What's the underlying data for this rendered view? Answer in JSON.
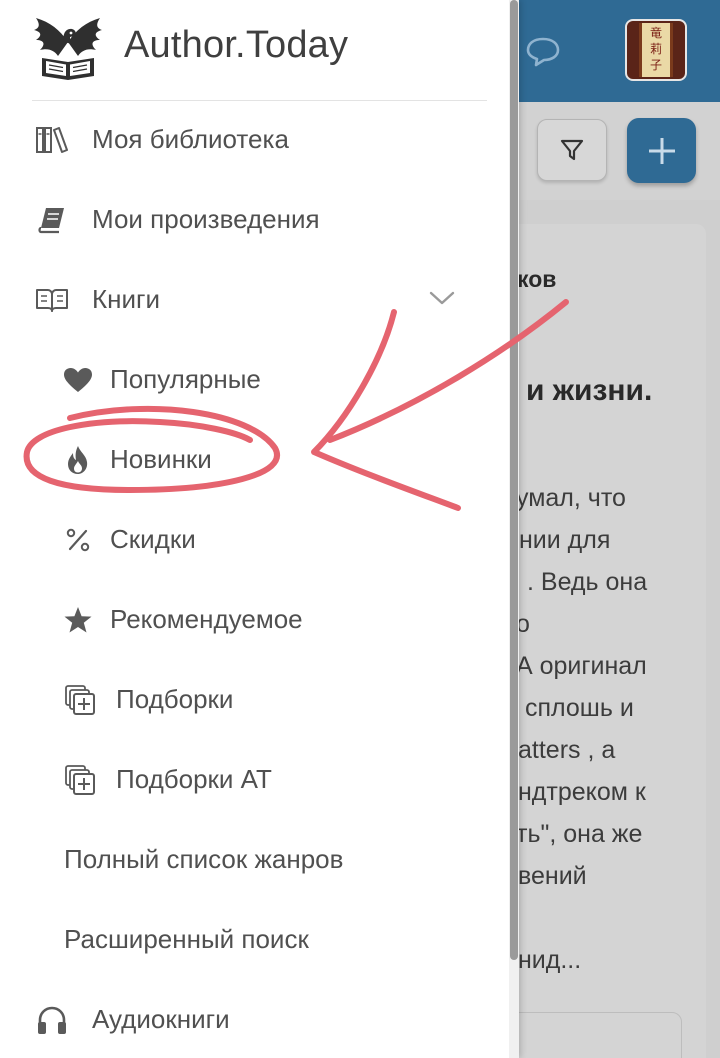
{
  "brand": {
    "name": "Author.Today",
    "logo_icon": "eagle-book-logo"
  },
  "menu": {
    "library": {
      "label": "Моя библиотека",
      "icon": "books-icon"
    },
    "my_works": {
      "label": "Мои произведения",
      "icon": "book-icon"
    },
    "books": {
      "label": "Книги",
      "icon": "open-book-icon",
      "expanded": true
    },
    "popular": {
      "label": "Популярные",
      "icon": "heart-icon"
    },
    "new": {
      "label": "Новинки",
      "icon": "flame-icon"
    },
    "discounts": {
      "label": "Скидки",
      "icon": "percent-icon"
    },
    "recommended": {
      "label": "Рекомендуемое",
      "icon": "star-icon"
    },
    "collections": {
      "label": "Подборки",
      "icon": "collections-icon"
    },
    "collections_at": {
      "label": "Подборки АТ",
      "icon": "collections-icon"
    },
    "all_genres": {
      "label": "Полный список жанров"
    },
    "advanced_search": {
      "label": "Расширенный поиск"
    },
    "audiobooks": {
      "label": "Аудиокниги",
      "icon": "headphones-icon"
    }
  },
  "background": {
    "fragments": [
      "ков",
      "и жизни.",
      "умал, что",
      "нии для",
      ". Ведь она",
      "о",
      "А оригинал",
      "сплошь и",
      "atters , а",
      "ндтреком к",
      "ть\", она же",
      "вений",
      "нид..."
    ],
    "avatar_text": [
      "竜",
      "莉",
      "子"
    ]
  },
  "colors": {
    "header_blue": "#2f6a94",
    "annotation_red": "#e5646f",
    "menu_text": "#505050",
    "icon_gray": "#5a5a5a"
  }
}
